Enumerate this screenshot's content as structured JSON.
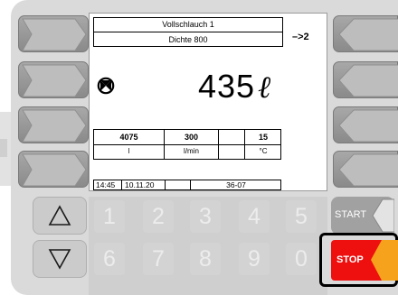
{
  "display": {
    "line1": "Vollschlauch 1",
    "line2": "Dichte 800",
    "arrow_next": "–>2",
    "volume": "435",
    "volume_unit": "ℓ",
    "table": {
      "values": [
        "4075",
        "300",
        "",
        "15"
      ],
      "units": [
        "l",
        "l/min",
        "",
        "°C"
      ]
    },
    "status": {
      "time": "14:45",
      "date": "10.11.20",
      "blank": "",
      "code": "36-07"
    }
  },
  "keypad": {
    "row1": [
      "1",
      "2",
      "3",
      "4",
      "5"
    ],
    "row2": [
      "6",
      "7",
      "8",
      "9",
      "0"
    ]
  },
  "buttons": {
    "start_label": "START",
    "stop_label": "STOP"
  },
  "colors": {
    "stop": "#ee0f0f",
    "stop_accent": "#f6a21c"
  },
  "icons": {
    "valve": "valve-icon",
    "up": "arrow-up-icon",
    "down": "arrow-down-icon"
  }
}
